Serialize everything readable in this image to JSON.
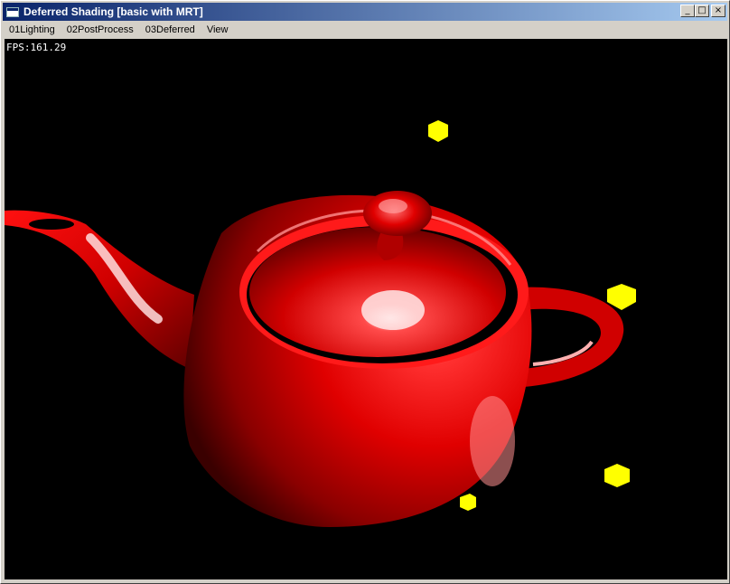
{
  "window": {
    "title": "Deferred Shading [basic with MRT]",
    "icon": "app-window-icon",
    "controls": {
      "minimize": "_",
      "maximize": "□",
      "close": "×"
    }
  },
  "menu": {
    "items": [
      {
        "label": "01Lighting"
      },
      {
        "label": "02PostProcess"
      },
      {
        "label": "03Deferred"
      },
      {
        "label": "View"
      }
    ]
  },
  "viewport": {
    "fps_text": "FPS:161.29",
    "background_color": "#000000",
    "teapot_color": "#ff0000",
    "light_color": "#ffff00"
  }
}
